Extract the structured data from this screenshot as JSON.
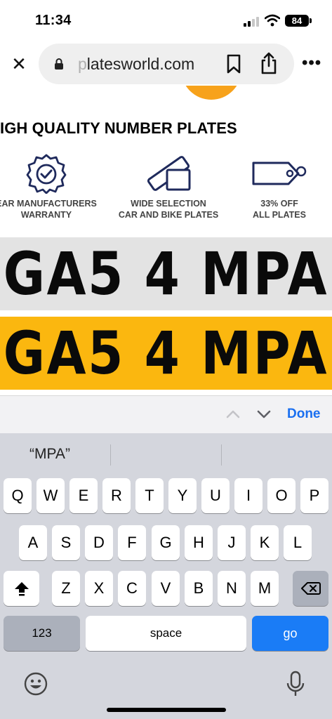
{
  "status_bar": {
    "time": "11:34",
    "battery": "84"
  },
  "browser": {
    "close_label": "✕",
    "url_faded": "p",
    "url_main": "latesworld.com",
    "more_label": "•••"
  },
  "page": {
    "headline": "IGH QUALITY NUMBER PLATES",
    "features": [
      {
        "icon": "warranty-badge-icon",
        "label": "EAR MANUFACTURERS\nWARRANTY"
      },
      {
        "icon": "plates-icon",
        "label": "WIDE SELECTION\nCAR AND BIKE PLATES"
      },
      {
        "icon": "price-tag-icon",
        "label": "33% OFF\nALL PLATES"
      }
    ],
    "plate_front": "GA5 4 MPA",
    "plate_rear": "GA5 4 MPA",
    "colors": {
      "front_plate": "#e3e3e3",
      "rear_plate": "#fbb70f",
      "accent": "#f7a21b"
    }
  },
  "find_bar": {
    "done_label": "Done"
  },
  "keyboard": {
    "suggestion": "“MPA”",
    "row1": [
      "Q",
      "W",
      "E",
      "R",
      "T",
      "Y",
      "U",
      "I",
      "O",
      "P"
    ],
    "row2": [
      "A",
      "S",
      "D",
      "F",
      "G",
      "H",
      "J",
      "K",
      "L"
    ],
    "row3": [
      "Z",
      "X",
      "C",
      "V",
      "B",
      "N",
      "M"
    ],
    "numbers_label": "123",
    "space_label": "space",
    "go_label": "go"
  }
}
